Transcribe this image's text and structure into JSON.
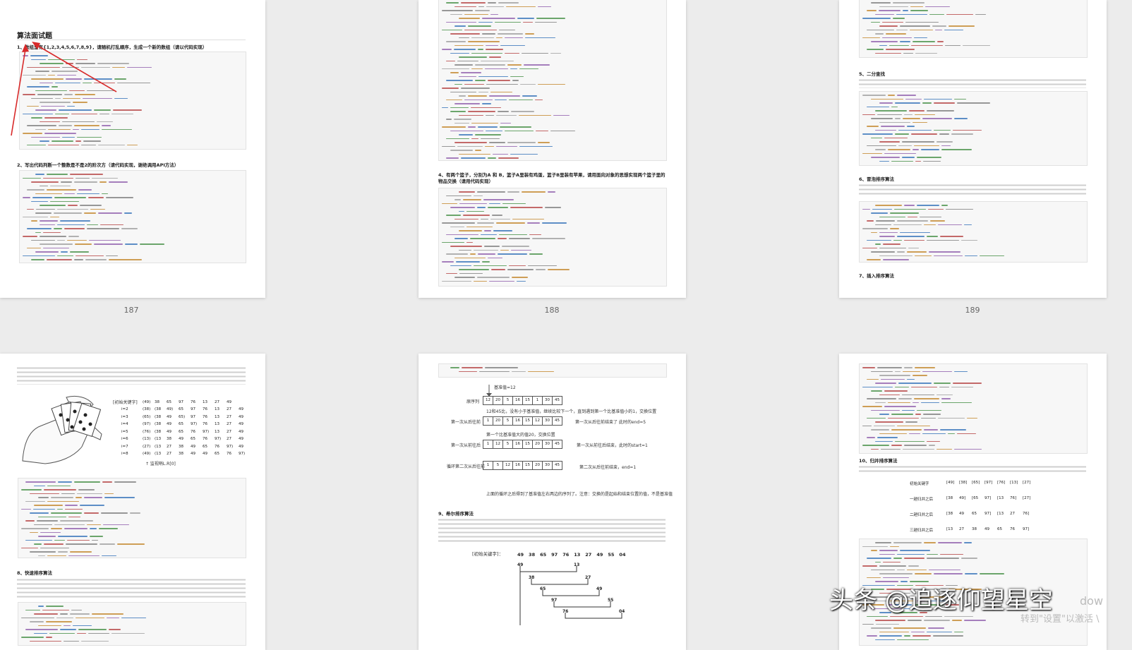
{
  "page_numbers": [
    "187",
    "188",
    "189"
  ],
  "p187": {
    "title": "算法面试题",
    "q1": "1、数组里有{1,2,3,4,5,6,7,8,9}，请随机打乱顺序，生成一个新的数组（请以代码实现）",
    "q2": "2、写出代码判断一个整数是不是2的阶次方（请代码实现，谢绝调用API方法）"
  },
  "p188": {
    "q4": "4、有两个篮子，分别为A 和 B，篮子A里装有鸡蛋，篮子B里装有苹果，请用面向对象的思想实现两个篮子里的物品交换（请用代码实现）"
  },
  "p189": {
    "s5": "5、二分查找",
    "s6": "6、冒泡排序算法",
    "s7": "7、插入排序算法"
  },
  "p190": {
    "table_title": "[初始关键字]",
    "footer": "↑ 监视哨L.R[0]",
    "s8": "8、快速排序算法",
    "rows": [
      {
        "label": "i=2",
        "cells": [
          "(38)",
          "(38",
          "49)",
          "65",
          "97",
          "76",
          "13",
          "27",
          "49"
        ]
      },
      {
        "label": "i=3",
        "cells": [
          "(65)",
          "(38",
          "49",
          "65)",
          "97",
          "76",
          "13",
          "27",
          "49"
        ]
      },
      {
        "label": "i=4",
        "cells": [
          "(97)",
          "(38",
          "49",
          "65",
          "97)",
          "76",
          "13",
          "27",
          "49"
        ]
      },
      {
        "label": "i=5",
        "cells": [
          "(76)",
          "(38",
          "49",
          "65",
          "76",
          "97)",
          "13",
          "27",
          "49"
        ]
      },
      {
        "label": "i=6",
        "cells": [
          "(13)",
          "(13",
          "38",
          "49",
          "65",
          "76",
          "97)",
          "27",
          "49"
        ]
      },
      {
        "label": "i=7",
        "cells": [
          "(27)",
          "(13",
          "27",
          "38",
          "49",
          "65",
          "76",
          "97)",
          "49"
        ]
      },
      {
        "label": "i=8",
        "cells": [
          "(49)",
          "(13",
          "27",
          "38",
          "49",
          "49",
          "65",
          "76",
          "97)"
        ]
      }
    ],
    "first_row": [
      "(49)",
      "38",
      "65",
      "97",
      "76",
      "13",
      "27",
      "49"
    ]
  },
  "p191": {
    "pivot_label": "基准值=12",
    "seq_label": "原序列",
    "seq": [
      "12",
      "20",
      "5",
      "16",
      "15",
      "1",
      "30",
      "45"
    ],
    "note1": "12和45比，没有小于基准值，继续比较下一个，直到遇到第一个比基准值小的1，交换位置",
    "row1_label": "第一次从后往前",
    "row1": [
      "1",
      "20",
      "5",
      "16",
      "15",
      "12",
      "30",
      "45"
    ],
    "row1_note": "第一次从后往前结束了  此时的end=5",
    "note2": "第一个比基准值大的值20，交换位置",
    "row2_label": "第一次从前往后",
    "row2": [
      "1",
      "12",
      "5",
      "16",
      "15",
      "20",
      "30",
      "45"
    ],
    "row2_note": "第一次从前往后结束，此时的start=1",
    "row3_label": "循环第二次从后往前",
    "row3": [
      "1",
      "5",
      "12",
      "16",
      "15",
      "20",
      "30",
      "45"
    ],
    "row3_note": "第二次从后往前结束，end=1",
    "summary": "上面的循环之后得到了基准值左右两边的序列了。注意：交换的是起始和结束位置的值，不是基准值",
    "s9": "9、希尔排序算法",
    "shell_label": "[初始关键字]：",
    "shell_seq": [
      "49",
      "38",
      "65",
      "97",
      "76",
      "13",
      "27",
      "49",
      "55",
      "04"
    ]
  },
  "p192": {
    "s10": "10、归并排序算法",
    "merge_rows": [
      {
        "label": "初始关键字",
        "vals": [
          "[49]",
          "[38]",
          "[65]",
          "[97]",
          "[76]",
          "[13]",
          "[27]"
        ]
      },
      {
        "label": "一趟归并之后",
        "vals": [
          "[38",
          "49]",
          "[65",
          "97]",
          "[13",
          "76]",
          "[27]"
        ]
      },
      {
        "label": "二趟归并之后",
        "vals": [
          "[38",
          "49",
          "65",
          "97]",
          "[13",
          "27",
          "76]"
        ]
      },
      {
        "label": "三趟归并之后",
        "vals": [
          "[13",
          "27",
          "38",
          "49",
          "65",
          "76",
          "97]"
        ]
      }
    ]
  },
  "watermark": {
    "text": "头条 @追逐仰望星空",
    "activate": "转到\"设置\"以激活 \\",
    "win": "dow"
  }
}
